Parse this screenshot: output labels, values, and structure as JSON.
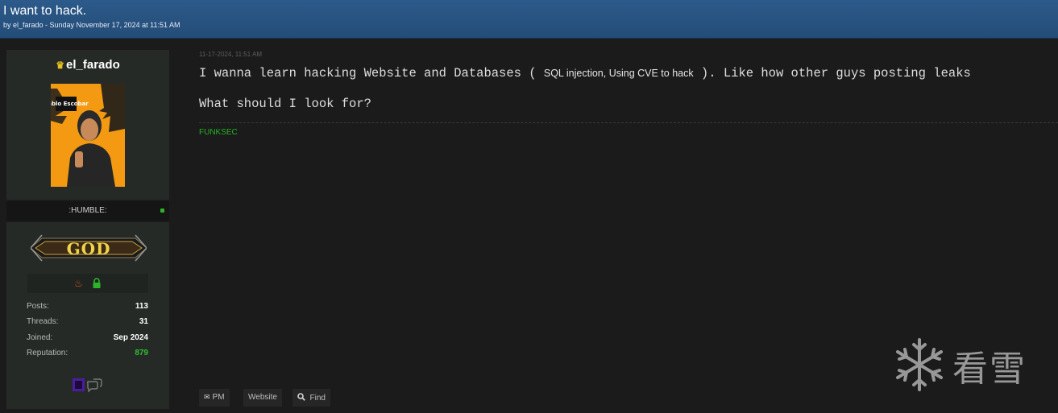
{
  "thread": {
    "title": "I want to hack.",
    "meta": "by el_farado - Sunday November 17, 2024 at 11:51 AM"
  },
  "user": {
    "crown_icon": "crown-icon",
    "username": "el_farado",
    "avatar_icon": "avatar-image",
    "avatar_text": "Pablo Escobar",
    "usertitle": ":HUMBLE:",
    "rank": "GOD",
    "awards": [
      {
        "icon": "flame-icon",
        "color": "#d9541a"
      },
      {
        "icon": "lock-icon",
        "color": "#2bb52b"
      }
    ],
    "stats": [
      {
        "label": "Posts:",
        "value": "113"
      },
      {
        "label": "Threads:",
        "value": "31"
      },
      {
        "label": "Joined:",
        "value": "Sep 2024"
      },
      {
        "label": "Reputation:",
        "value": "879"
      }
    ],
    "contact_icons": [
      "purple-badge-icon",
      "chat-bubbles-icon"
    ]
  },
  "post": {
    "date": "11-17-2024, 11:51 AM",
    "line1_start": "I wanna learn hacking Website and Databases",
    "line1_paren_open": " ( ",
    "line1_inline": "SQL injection, Using CVE to hack",
    "line1_paren_close": " ). ",
    "line1_end": "Like how other guys posting leaks",
    "line2": "What should I look for?",
    "signature": "FUNKSEC"
  },
  "buttons": [
    {
      "label": "PM",
      "icon": "envelope-icon"
    },
    {
      "label": "Website",
      "icon": ""
    },
    {
      "label": "Find",
      "icon": "search-icon"
    }
  ],
  "watermark": {
    "text": "看雪",
    "icon": "snowflake-icon"
  },
  "colors": {
    "header_bg": "#2c5a8a",
    "page_bg": "#1b1b1b",
    "panel_bg": "#252a27",
    "signature": "#24b324",
    "reputation": "#2fc02f",
    "rank_gold": "#f0d44a"
  }
}
